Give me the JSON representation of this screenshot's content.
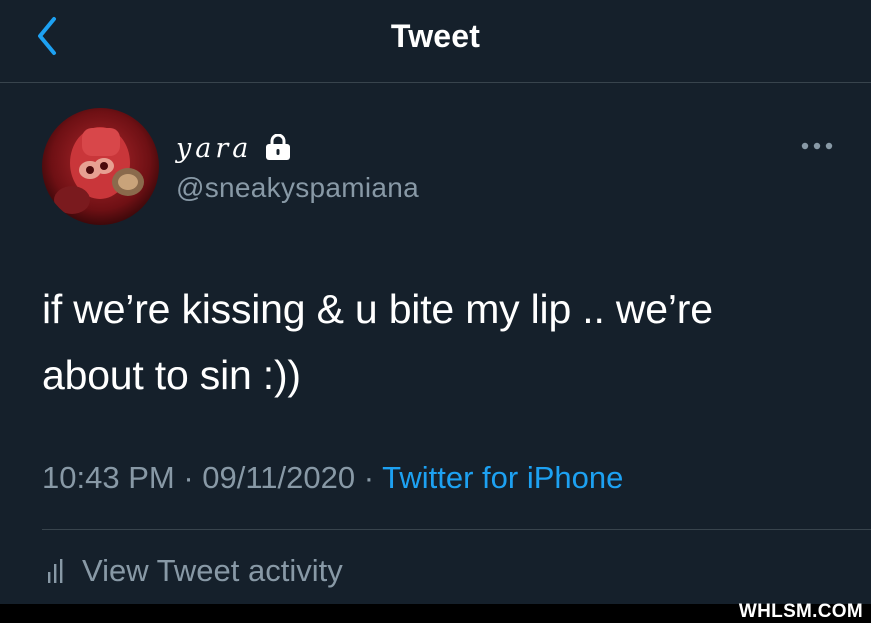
{
  "header": {
    "title": "Tweet",
    "back_icon": "chevron-left-icon"
  },
  "tweet": {
    "display_name": "yara",
    "protected_icon": "lock-icon",
    "handle": "@sneakyspamiana",
    "text_line1": "if we’re kissing & u bite my lip .. we’re",
    "text_line2": "about to sin :))",
    "time": "10:43 PM",
    "separator": " · ",
    "date": "09/11/2020",
    "source": "Twitter for iPhone",
    "more_icon": "ellipsis-icon"
  },
  "activity": {
    "label": "View Tweet activity",
    "icon": "bar-chart-icon"
  },
  "watermark": "WHLSM.COM",
  "colors": {
    "background": "#15202b",
    "divider": "#38444d",
    "accent": "#1da1f2",
    "secondary_text": "#8899a6"
  }
}
